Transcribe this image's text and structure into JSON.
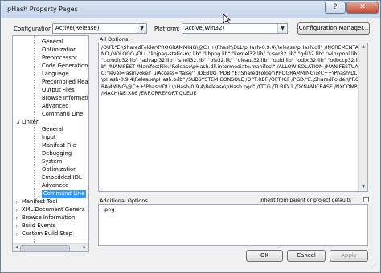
{
  "window": {
    "title": "pHash Property Pages",
    "help_glyph": "?",
    "close_glyph": "✕"
  },
  "toolbar": {
    "configuration_label": "Configuration:",
    "configuration_value": "Active(Release)",
    "platform_label": "Platform:",
    "platform_value": "Active(Win32)",
    "config_manager_label": "Configuration Manager..."
  },
  "tree": {
    "items": [
      {
        "label": "General",
        "level": 2,
        "toggle": ""
      },
      {
        "label": "Optimization",
        "level": 2,
        "toggle": ""
      },
      {
        "label": "Preprocessor",
        "level": 2,
        "toggle": ""
      },
      {
        "label": "Code Generation",
        "level": 2,
        "toggle": ""
      },
      {
        "label": "Language",
        "level": 2,
        "toggle": ""
      },
      {
        "label": "Precompiled Heade",
        "level": 2,
        "toggle": ""
      },
      {
        "label": "Output Files",
        "level": 2,
        "toggle": ""
      },
      {
        "label": "Browse Information",
        "level": 2,
        "toggle": ""
      },
      {
        "label": "Advanced",
        "level": 2,
        "toggle": ""
      },
      {
        "label": "Command Line",
        "level": 2,
        "toggle": ""
      },
      {
        "label": "Linker",
        "level": 1,
        "toggle": "◢"
      },
      {
        "label": "General",
        "level": 2,
        "toggle": ""
      },
      {
        "label": "Input",
        "level": 2,
        "toggle": ""
      },
      {
        "label": "Manifest File",
        "level": 2,
        "toggle": ""
      },
      {
        "label": "Debugging",
        "level": 2,
        "toggle": ""
      },
      {
        "label": "System",
        "level": 2,
        "toggle": ""
      },
      {
        "label": "Optimization",
        "level": 2,
        "toggle": ""
      },
      {
        "label": "Embedded IDL",
        "level": 2,
        "toggle": ""
      },
      {
        "label": "Advanced",
        "level": 2,
        "toggle": ""
      },
      {
        "label": "Command Line",
        "level": 2,
        "toggle": "",
        "selected": true
      },
      {
        "label": "Manifest Tool",
        "level": 1,
        "toggle": "▷"
      },
      {
        "label": "XML Document Genera",
        "level": 1,
        "toggle": "▷"
      },
      {
        "label": "Browse Information",
        "level": 1,
        "toggle": "▷"
      },
      {
        "label": "Build Events",
        "level": 1,
        "toggle": "▷"
      },
      {
        "label": "Custom Build Step",
        "level": 1,
        "toggle": "▷"
      }
    ]
  },
  "all_options": {
    "label": "All Options:",
    "text": "/OUT:\"E:\\SharedFolder\\PROGRAMMING\\@C++\\Phash\\DLL\\pHash-0.9.4\\Release\\pHash.dll\" /INCREMENTAL:NO /NOLOGO /DLL \"libjpeg-static-mt.lib\" \"libpng.lib\" \"kernel32.lib\" \"user32.lib\" \"gdi32.lib\" \"winspool.lib\" \"comdlg32.lib\" \"advapi32.lib\" \"shell32.lib\" \"ole32.lib\" \"oleaut32.lib\" \"uuid.lib\" \"odbc32.lib\" \"odbccp32.lib\" /MANIFEST /ManifestFile:\"Release\\pHash.dll.intermediate.manifest\" /ALLOWISOLATION /MANIFESTUAC:\"level='asInvoker' uiAccess='false'\" /DEBUG /PDB:\"E:\\SharedFolder\\PROGRAMMING\\@C++\\Phash\\DLL\\pHash-0.9.4\\Release\\pHash.pdb\" /SUBSYSTEM:CONSOLE /OPT:REF /OPT:ICF /PGD:\"E:\\SharedFolder\\PROGRAMMING\\@C++\\Phash\\DLL\\pHash-0.9.4\\Release\\pHash.pgd\" /LTCG /TLBID:1 /DYNAMICBASE /NXCOMPAT /MACHINE:X86 /ERRORREPORT:QUEUE"
  },
  "additional_options": {
    "label": "Additional Options",
    "inherit_label": "Inherit from parent or project defaults",
    "value": "-lpng"
  },
  "buttons": {
    "ok": "OK",
    "cancel": "Cancel",
    "apply": "Apply"
  }
}
